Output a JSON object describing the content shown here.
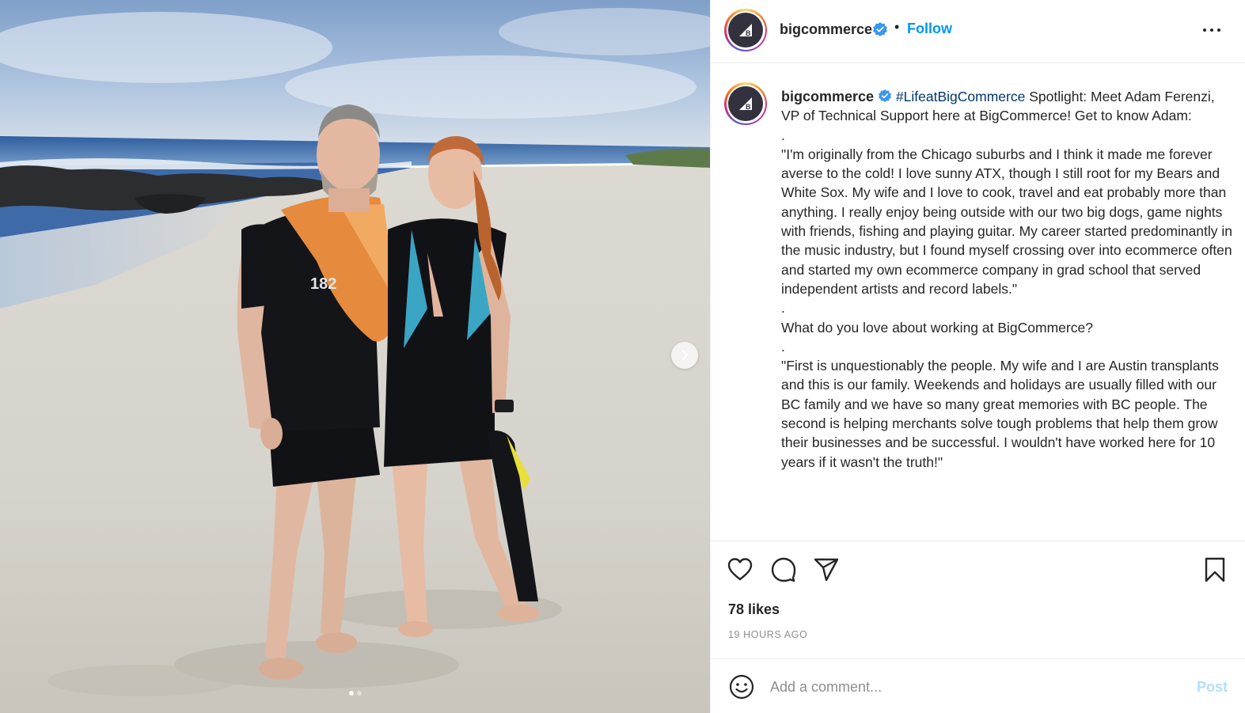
{
  "post": {
    "account": {
      "username": "bigcommerce",
      "verified": true,
      "separator": "•",
      "follow_label": "Follow",
      "avatar_letter": "B"
    },
    "caption": {
      "username": "bigcommerce",
      "hashtag": "#LifeatBigCommerce",
      "paragraphs": [
        "Spotlight: Meet Adam Ferenzi, VP of Technical Support here at BigCommerce! Get to know Adam:",
        ".",
        "\"I'm originally from the Chicago suburbs and I think it made me forever averse to the cold! I love sunny ATX, though I still root for my Bears and White Sox. My wife and I love to cook, travel and eat probably more than anything. I really enjoy being outside with our two big dogs, game nights with friends, fishing and playing guitar. My career started predominantly in the music industry, but I found myself crossing over into ecommerce often and started my own ecommerce company in grad school that served independent artists and record labels.\"",
        ".",
        "What do you love about working at BigCommerce?",
        ".",
        "\"First is unquestionably the people. My wife and I are Austin transplants and this is our family. Weekends and holidays are usually filled with our BC family and we have so many great memories with BC people. The second is helping merchants solve tough problems that help them grow their businesses and be successful. I wouldn't have worked here for 10 years if it wasn't the truth!\""
      ]
    },
    "likes_label": "78 likes",
    "timestamp": "19 HOURS AGO",
    "comment_placeholder": "Add a comment...",
    "post_label": "Post",
    "carousel": {
      "count": 2,
      "active_index": 0
    }
  },
  "icons": {
    "like": "heart-icon",
    "comment": "comment-icon",
    "share": "share-icon",
    "save": "bookmark-icon",
    "emoji": "emoji-icon",
    "more": "more-options-icon",
    "verified": "verified-badge-icon",
    "next": "chevron-right-icon"
  },
  "colors": {
    "accent": "#0095f6",
    "post_disabled": "#b2dffc",
    "text": "#262626",
    "muted": "#8e8e8e",
    "hashtag": "#00376b"
  }
}
